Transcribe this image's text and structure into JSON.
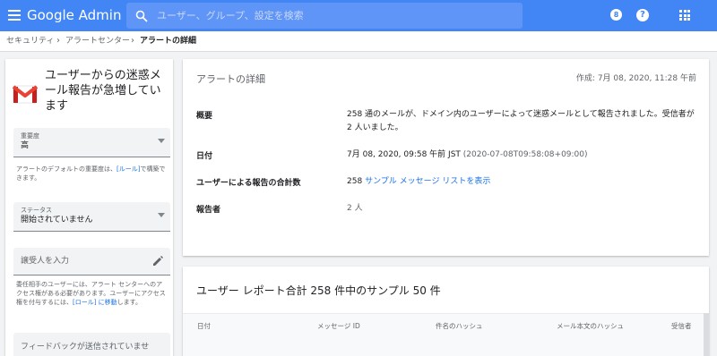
{
  "header": {
    "brand": "Google Admin",
    "search_placeholder": "ユーザー、グループ、設定を検索",
    "notification_badge": "8",
    "help_label": "?",
    "accent_color": "#4285f4"
  },
  "breadcrumb": [
    "セキュリティ",
    "アラートセンター",
    "アラートの詳細"
  ],
  "left_panel": {
    "title": "ユーザーからの迷惑メール報告が急増しています",
    "severity": {
      "label": "重要度",
      "value": "高"
    },
    "severity_help": "アラートのデフォルトの重要度は、",
    "severity_help_link": "[ルール]",
    "severity_help_tail": "で構築できます。",
    "status": {
      "label": "ステータス",
      "value": "開始されていません"
    },
    "assignee_placeholder": "譲受人を入力",
    "assignee_help": "委任相手のユーザーには、アラート センターへのアクセス権がある必要があります。ユーザーにアクセス権を付与するには、",
    "assignee_help_link": "[ロール] に移動",
    "assignee_help_tail": "します。",
    "partial_field": "フィードバックが送信されていませ"
  },
  "details": {
    "title": "アラートの詳細",
    "created": "作成: 7月 08, 2020, 11:28 午前",
    "rows": [
      {
        "label": "概要",
        "value": "258 通のメールが、ドメイン内のユーザーによって迷惑メールとして報告されました。受信者が 2 人いました。"
      },
      {
        "label": "日付",
        "value": "7月 08, 2020, 09:58 午前 JST",
        "value_extra": "(2020-07-08T09:58:08+09:00)"
      },
      {
        "label": "ユーザーによる報告の合計数",
        "value": "258",
        "link": "サンプル メッセージ リストを表示"
      },
      {
        "label": "報告者",
        "value": "2 人"
      }
    ]
  },
  "sample": {
    "title": "ユーザー レポート合計 258 件中のサンプル 50 件",
    "columns": [
      "日付",
      "メッセージ ID",
      "件名のハッシュ",
      "メール本文のハッシュ",
      "受信者"
    ]
  }
}
